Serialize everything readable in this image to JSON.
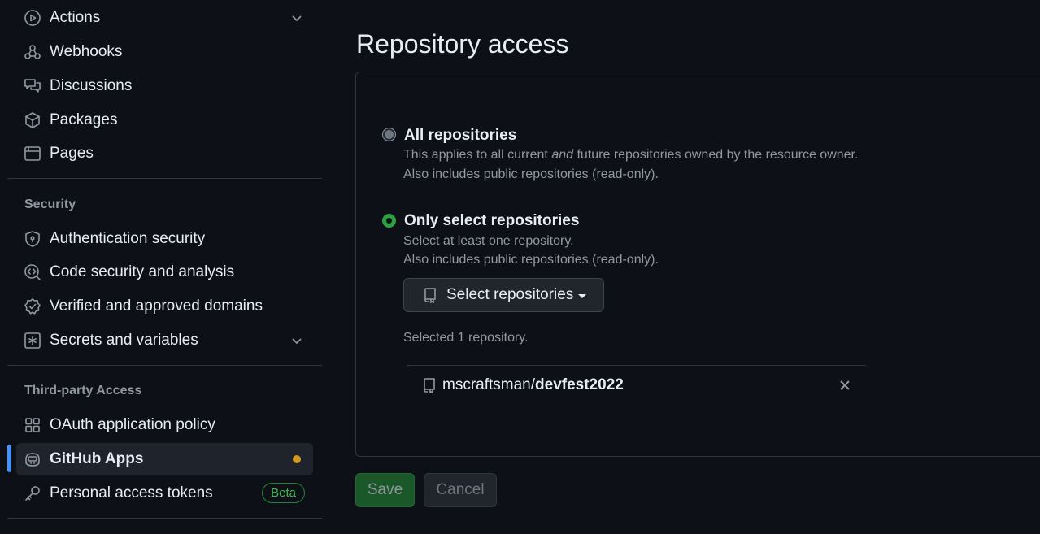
{
  "sidebar": {
    "items_top": [
      {
        "label": "Actions",
        "icon": "play-icon",
        "chevron": true
      },
      {
        "label": "Webhooks",
        "icon": "webhook-icon"
      },
      {
        "label": "Discussions",
        "icon": "comment-discussion-icon"
      },
      {
        "label": "Packages",
        "icon": "package-icon"
      },
      {
        "label": "Pages",
        "icon": "browser-icon"
      }
    ],
    "security_title": "Security",
    "security_items": [
      {
        "label": "Authentication security",
        "icon": "shield-lock-icon"
      },
      {
        "label": "Code security and analysis",
        "icon": "codescan-icon"
      },
      {
        "label": "Verified and approved domains",
        "icon": "verified-icon"
      },
      {
        "label": "Secrets and variables",
        "icon": "key-asterisk-icon",
        "chevron": true
      }
    ],
    "third_party_title": "Third-party Access",
    "third_party_items": [
      {
        "label": "OAuth application policy",
        "icon": "apps-icon"
      },
      {
        "label": "GitHub Apps",
        "icon": "copilot-icon",
        "active": true
      },
      {
        "label": "Personal access tokens",
        "icon": "key-icon",
        "badge": "Beta"
      }
    ]
  },
  "main": {
    "title": "Repository access",
    "all_repos": {
      "label": "All repositories",
      "desc_1_pre": "This applies to all current ",
      "desc_1_em": "and",
      "desc_1_post": " future repositories owned by the resource owner.",
      "desc_2": "Also includes public repositories (read-only).",
      "selected": false
    },
    "select_repos": {
      "label": "Only select repositories",
      "desc_1": "Select at least one repository.",
      "desc_2": "Also includes public repositories (read-only).",
      "selected": true
    },
    "select_button": "Select repositories",
    "selected_count": "Selected 1 repository.",
    "repos": [
      {
        "owner": "mscraftsman/",
        "name": "devfest2022"
      }
    ],
    "save_label": "Save",
    "cancel_label": "Cancel"
  },
  "colors": {
    "background": "#0d1117",
    "accent_blue": "#4493f8",
    "success_green": "#238636",
    "attention_dot": "#d29922"
  }
}
